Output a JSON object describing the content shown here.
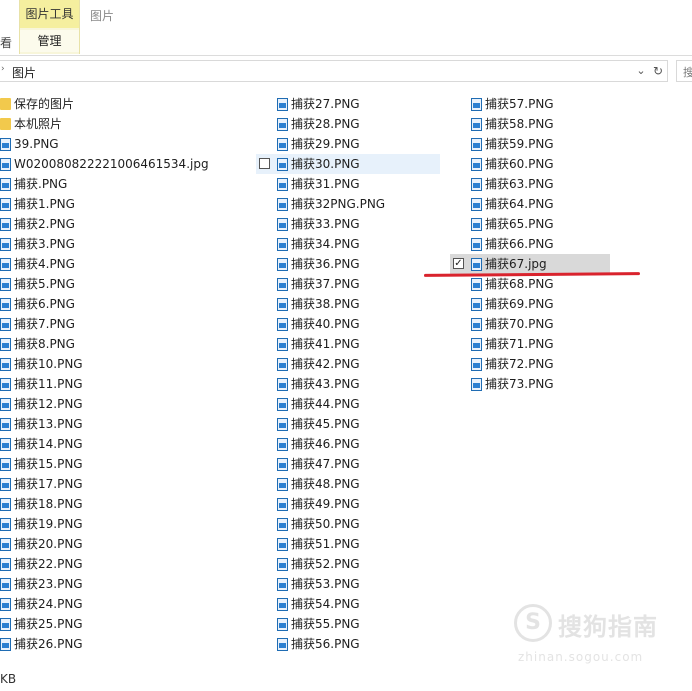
{
  "ribbon": {
    "context_group_title": "图片工具",
    "context_tab": "管理",
    "tab_plain": "图片",
    "left_tab_fragment": "看"
  },
  "address": {
    "path": "图片",
    "dropdown_icon": "chevron-down-icon",
    "refresh_icon": "refresh-icon"
  },
  "search": {
    "fragment": "搜"
  },
  "files": {
    "col1": [
      {
        "name": "保存的图片",
        "type": "folder"
      },
      {
        "name": "本机照片",
        "type": "folder"
      },
      {
        "name": "39.PNG",
        "type": "image"
      },
      {
        "name": "W020080822221006461534.jpg",
        "type": "image"
      },
      {
        "name": "捕获.PNG",
        "type": "image"
      },
      {
        "name": "捕获1.PNG",
        "type": "image"
      },
      {
        "name": "捕获2.PNG",
        "type": "image"
      },
      {
        "name": "捕获3.PNG",
        "type": "image"
      },
      {
        "name": "捕获4.PNG",
        "type": "image"
      },
      {
        "name": "捕获5.PNG",
        "type": "image"
      },
      {
        "name": "捕获6.PNG",
        "type": "image"
      },
      {
        "name": "捕获7.PNG",
        "type": "image"
      },
      {
        "name": "捕获8.PNG",
        "type": "image"
      },
      {
        "name": "捕获10.PNG",
        "type": "image"
      },
      {
        "name": "捕获11.PNG",
        "type": "image"
      },
      {
        "name": "捕获12.PNG",
        "type": "image"
      },
      {
        "name": "捕获13.PNG",
        "type": "image"
      },
      {
        "name": "捕获14.PNG",
        "type": "image"
      },
      {
        "name": "捕获15.PNG",
        "type": "image"
      },
      {
        "name": "捕获17.PNG",
        "type": "image"
      },
      {
        "name": "捕获18.PNG",
        "type": "image"
      },
      {
        "name": "捕获19.PNG",
        "type": "image"
      },
      {
        "name": "捕获20.PNG",
        "type": "image"
      },
      {
        "name": "捕获22.PNG",
        "type": "image"
      },
      {
        "name": "捕获23.PNG",
        "type": "image"
      },
      {
        "name": "捕获24.PNG",
        "type": "image"
      },
      {
        "name": "捕获25.PNG",
        "type": "image"
      },
      {
        "name": "捕获26.PNG",
        "type": "image"
      }
    ],
    "col2": [
      {
        "name": "捕获27.PNG"
      },
      {
        "name": "捕获28.PNG"
      },
      {
        "name": "捕获29.PNG"
      },
      {
        "name": "捕获30.PNG",
        "hover": true
      },
      {
        "name": "捕获31.PNG"
      },
      {
        "name": "捕获32PNG.PNG"
      },
      {
        "name": "捕获33.PNG"
      },
      {
        "name": "捕获34.PNG"
      },
      {
        "name": "捕获36.PNG"
      },
      {
        "name": "捕获37.PNG"
      },
      {
        "name": "捕获38.PNG"
      },
      {
        "name": "捕获40.PNG"
      },
      {
        "name": "捕获41.PNG"
      },
      {
        "name": "捕获42.PNG"
      },
      {
        "name": "捕获43.PNG"
      },
      {
        "name": "捕获44.PNG"
      },
      {
        "name": "捕获45.PNG"
      },
      {
        "name": "捕获46.PNG"
      },
      {
        "name": "捕获47.PNG"
      },
      {
        "name": "捕获48.PNG"
      },
      {
        "name": "捕获49.PNG"
      },
      {
        "name": "捕获50.PNG"
      },
      {
        "name": "捕获51.PNG"
      },
      {
        "name": "捕获52.PNG"
      },
      {
        "name": "捕获53.PNG"
      },
      {
        "name": "捕获54.PNG"
      },
      {
        "name": "捕获55.PNG"
      },
      {
        "name": "捕获56.PNG"
      }
    ],
    "col3": [
      {
        "name": "捕获57.PNG"
      },
      {
        "name": "捕获58.PNG"
      },
      {
        "name": "捕获59.PNG"
      },
      {
        "name": "捕获60.PNG"
      },
      {
        "name": "捕获63.PNG"
      },
      {
        "name": "捕获64.PNG"
      },
      {
        "name": "捕获65.PNG"
      },
      {
        "name": "捕获66.PNG"
      },
      {
        "name": "捕获67.jpg",
        "selected": true
      },
      {
        "name": "捕获68.PNG"
      },
      {
        "name": "捕获69.PNG"
      },
      {
        "name": "捕获70.PNG"
      },
      {
        "name": "捕获71.PNG"
      },
      {
        "name": "捕获72.PNG"
      },
      {
        "name": "捕获73.PNG"
      }
    ]
  },
  "status": {
    "fragment": "KB"
  },
  "watermark": {
    "text": "搜狗指南",
    "sub": "zhinan.sogou.com",
    "glyph": "S"
  },
  "colors": {
    "selection": "#d9d9d9",
    "hover": "#e7f1fb",
    "annotation": "#d9232d",
    "context_tab": "#f5ef9f"
  }
}
